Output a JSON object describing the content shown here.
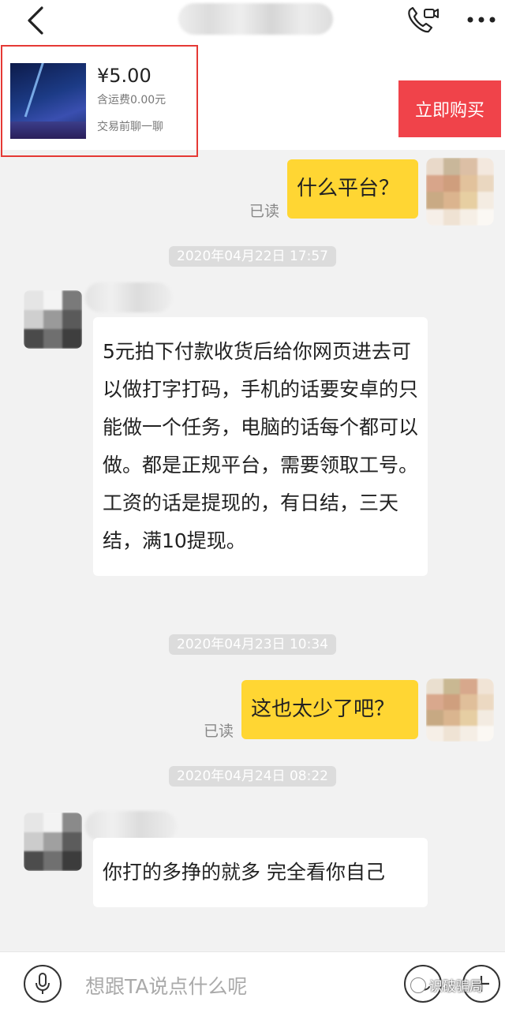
{
  "product": {
    "price": "¥5.00",
    "shipping": "含运费0.00元",
    "chat_before_trade": "交易前聊一聊",
    "buy_label": "立即购买"
  },
  "messages": [
    {
      "from": "me",
      "text": "什么平台？",
      "read_label": "已读"
    },
    {
      "timestamp": "2020年04月22日 17:57"
    },
    {
      "from": "them",
      "text": "5元拍下付款收货后给你网页进去可以做打字打码，手机的话要安卓的只能做一个任务，电脑的话每个都可以做。都是正规平台，需要领取工号。工资的话是提现的，有日结，三天结，满10提现。"
    },
    {
      "timestamp": "2020年04月23日 10:34"
    },
    {
      "from": "me",
      "text": "这也太少了吧？",
      "read_label": "已读"
    },
    {
      "timestamp": "2020年04月24日 08:22"
    },
    {
      "from": "them",
      "text": "你打的多挣的就多 完全看你自己"
    }
  ],
  "input": {
    "placeholder": "想跟TA说点什么呢"
  },
  "watermark": "识破骗局",
  "colors": {
    "buy_button": "#f0434a",
    "my_bubble": "#ffd633",
    "highlight_frame": "#e53935"
  }
}
